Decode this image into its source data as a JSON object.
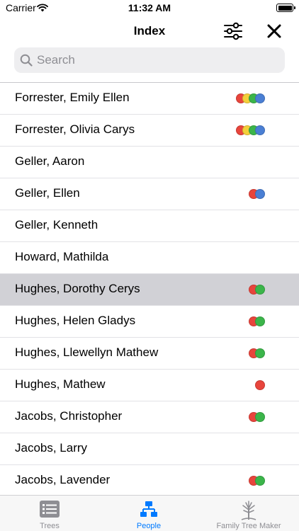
{
  "status_bar": {
    "carrier": "Carrier",
    "time": "11:32 AM"
  },
  "nav": {
    "title": "Index",
    "filter_icon": "sliders-icon",
    "close_icon": "close-icon"
  },
  "search": {
    "placeholder": "Search",
    "value": ""
  },
  "people": [
    {
      "name": "Forrester, Emily Ellen",
      "selected": false,
      "dots": [
        "#e8453c",
        "#f4cf3a",
        "#3bb54a",
        "#4a7fd4"
      ]
    },
    {
      "name": "Forrester, Olivia Carys",
      "selected": false,
      "dots": [
        "#e8453c",
        "#f4cf3a",
        "#3bb54a",
        "#4a7fd4"
      ]
    },
    {
      "name": "Geller, Aaron",
      "selected": false,
      "dots": []
    },
    {
      "name": "Geller, Ellen",
      "selected": false,
      "dots": [
        "#e8453c",
        "#4a7fd4"
      ]
    },
    {
      "name": "Geller, Kenneth",
      "selected": false,
      "dots": []
    },
    {
      "name": "Howard, Mathilda",
      "selected": false,
      "dots": []
    },
    {
      "name": "Hughes, Dorothy Cerys",
      "selected": true,
      "dots": [
        "#e8453c",
        "#3bb54a"
      ]
    },
    {
      "name": "Hughes, Helen Gladys",
      "selected": false,
      "dots": [
        "#e8453c",
        "#3bb54a"
      ]
    },
    {
      "name": "Hughes, Llewellyn Mathew",
      "selected": false,
      "dots": [
        "#e8453c",
        "#3bb54a"
      ]
    },
    {
      "name": "Hughes, Mathew",
      "selected": false,
      "dots": [
        "#e8453c"
      ]
    },
    {
      "name": "Jacobs, Christopher",
      "selected": false,
      "dots": [
        "#e8453c",
        "#3bb54a"
      ]
    },
    {
      "name": "Jacobs, Larry",
      "selected": false,
      "dots": []
    },
    {
      "name": "Jacobs, Lavender",
      "selected": false,
      "dots": [
        "#e8453c",
        "#3bb54a"
      ]
    }
  ],
  "tabs": [
    {
      "label": "Trees",
      "icon": "list-icon",
      "active": false
    },
    {
      "label": "People",
      "icon": "people-tree-icon",
      "active": true
    },
    {
      "label": "Family Tree Maker",
      "icon": "tree-logo-icon",
      "active": false
    }
  ],
  "colors": {
    "accent": "#007aff",
    "selected_row": "#d1d1d6",
    "inactive_tab": "#8e8e93"
  }
}
